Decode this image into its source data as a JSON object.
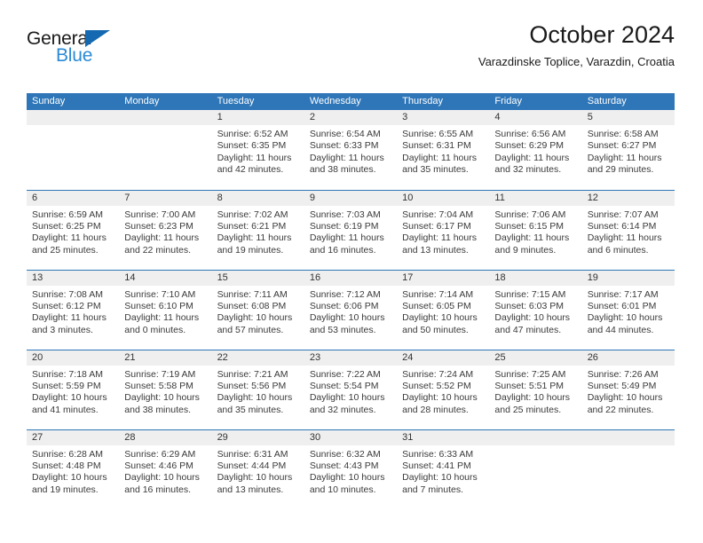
{
  "brand": {
    "name_part1": "General",
    "name_part2": "Blue",
    "color_dark": "#1a1a1a",
    "color_blue": "#2b8ad6",
    "triangle_color": "#1569b0"
  },
  "header": {
    "title": "October 2024",
    "subtitle": "Varazdinske Toplice, Varazdin, Croatia"
  },
  "theme": {
    "header_band": "#2e76b8",
    "date_band": "#efefef",
    "row_border": "#2e76b8",
    "body_text": "#3a3a3a"
  },
  "weekdays": [
    "Sunday",
    "Monday",
    "Tuesday",
    "Wednesday",
    "Thursday",
    "Friday",
    "Saturday"
  ],
  "weeks": [
    [
      {
        "day": "",
        "sunrise": "",
        "sunset": "",
        "daylight_line1": "",
        "daylight_line2": "",
        "empty": true
      },
      {
        "day": "",
        "sunrise": "",
        "sunset": "",
        "daylight_line1": "",
        "daylight_line2": "",
        "empty": true
      },
      {
        "day": "1",
        "sunrise": "Sunrise: 6:52 AM",
        "sunset": "Sunset: 6:35 PM",
        "daylight_line1": "Daylight: 11 hours",
        "daylight_line2": "and 42 minutes."
      },
      {
        "day": "2",
        "sunrise": "Sunrise: 6:54 AM",
        "sunset": "Sunset: 6:33 PM",
        "daylight_line1": "Daylight: 11 hours",
        "daylight_line2": "and 38 minutes."
      },
      {
        "day": "3",
        "sunrise": "Sunrise: 6:55 AM",
        "sunset": "Sunset: 6:31 PM",
        "daylight_line1": "Daylight: 11 hours",
        "daylight_line2": "and 35 minutes."
      },
      {
        "day": "4",
        "sunrise": "Sunrise: 6:56 AM",
        "sunset": "Sunset: 6:29 PM",
        "daylight_line1": "Daylight: 11 hours",
        "daylight_line2": "and 32 minutes."
      },
      {
        "day": "5",
        "sunrise": "Sunrise: 6:58 AM",
        "sunset": "Sunset: 6:27 PM",
        "daylight_line1": "Daylight: 11 hours",
        "daylight_line2": "and 29 minutes."
      }
    ],
    [
      {
        "day": "6",
        "sunrise": "Sunrise: 6:59 AM",
        "sunset": "Sunset: 6:25 PM",
        "daylight_line1": "Daylight: 11 hours",
        "daylight_line2": "and 25 minutes."
      },
      {
        "day": "7",
        "sunrise": "Sunrise: 7:00 AM",
        "sunset": "Sunset: 6:23 PM",
        "daylight_line1": "Daylight: 11 hours",
        "daylight_line2": "and 22 minutes."
      },
      {
        "day": "8",
        "sunrise": "Sunrise: 7:02 AM",
        "sunset": "Sunset: 6:21 PM",
        "daylight_line1": "Daylight: 11 hours",
        "daylight_line2": "and 19 minutes."
      },
      {
        "day": "9",
        "sunrise": "Sunrise: 7:03 AM",
        "sunset": "Sunset: 6:19 PM",
        "daylight_line1": "Daylight: 11 hours",
        "daylight_line2": "and 16 minutes."
      },
      {
        "day": "10",
        "sunrise": "Sunrise: 7:04 AM",
        "sunset": "Sunset: 6:17 PM",
        "daylight_line1": "Daylight: 11 hours",
        "daylight_line2": "and 13 minutes."
      },
      {
        "day": "11",
        "sunrise": "Sunrise: 7:06 AM",
        "sunset": "Sunset: 6:15 PM",
        "daylight_line1": "Daylight: 11 hours",
        "daylight_line2": "and 9 minutes."
      },
      {
        "day": "12",
        "sunrise": "Sunrise: 7:07 AM",
        "sunset": "Sunset: 6:14 PM",
        "daylight_line1": "Daylight: 11 hours",
        "daylight_line2": "and 6 minutes."
      }
    ],
    [
      {
        "day": "13",
        "sunrise": "Sunrise: 7:08 AM",
        "sunset": "Sunset: 6:12 PM",
        "daylight_line1": "Daylight: 11 hours",
        "daylight_line2": "and 3 minutes."
      },
      {
        "day": "14",
        "sunrise": "Sunrise: 7:10 AM",
        "sunset": "Sunset: 6:10 PM",
        "daylight_line1": "Daylight: 11 hours",
        "daylight_line2": "and 0 minutes."
      },
      {
        "day": "15",
        "sunrise": "Sunrise: 7:11 AM",
        "sunset": "Sunset: 6:08 PM",
        "daylight_line1": "Daylight: 10 hours",
        "daylight_line2": "and 57 minutes."
      },
      {
        "day": "16",
        "sunrise": "Sunrise: 7:12 AM",
        "sunset": "Sunset: 6:06 PM",
        "daylight_line1": "Daylight: 10 hours",
        "daylight_line2": "and 53 minutes."
      },
      {
        "day": "17",
        "sunrise": "Sunrise: 7:14 AM",
        "sunset": "Sunset: 6:05 PM",
        "daylight_line1": "Daylight: 10 hours",
        "daylight_line2": "and 50 minutes."
      },
      {
        "day": "18",
        "sunrise": "Sunrise: 7:15 AM",
        "sunset": "Sunset: 6:03 PM",
        "daylight_line1": "Daylight: 10 hours",
        "daylight_line2": "and 47 minutes."
      },
      {
        "day": "19",
        "sunrise": "Sunrise: 7:17 AM",
        "sunset": "Sunset: 6:01 PM",
        "daylight_line1": "Daylight: 10 hours",
        "daylight_line2": "and 44 minutes."
      }
    ],
    [
      {
        "day": "20",
        "sunrise": "Sunrise: 7:18 AM",
        "sunset": "Sunset: 5:59 PM",
        "daylight_line1": "Daylight: 10 hours",
        "daylight_line2": "and 41 minutes."
      },
      {
        "day": "21",
        "sunrise": "Sunrise: 7:19 AM",
        "sunset": "Sunset: 5:58 PM",
        "daylight_line1": "Daylight: 10 hours",
        "daylight_line2": "and 38 minutes."
      },
      {
        "day": "22",
        "sunrise": "Sunrise: 7:21 AM",
        "sunset": "Sunset: 5:56 PM",
        "daylight_line1": "Daylight: 10 hours",
        "daylight_line2": "and 35 minutes."
      },
      {
        "day": "23",
        "sunrise": "Sunrise: 7:22 AM",
        "sunset": "Sunset: 5:54 PM",
        "daylight_line1": "Daylight: 10 hours",
        "daylight_line2": "and 32 minutes."
      },
      {
        "day": "24",
        "sunrise": "Sunrise: 7:24 AM",
        "sunset": "Sunset: 5:52 PM",
        "daylight_line1": "Daylight: 10 hours",
        "daylight_line2": "and 28 minutes."
      },
      {
        "day": "25",
        "sunrise": "Sunrise: 7:25 AM",
        "sunset": "Sunset: 5:51 PM",
        "daylight_line1": "Daylight: 10 hours",
        "daylight_line2": "and 25 minutes."
      },
      {
        "day": "26",
        "sunrise": "Sunrise: 7:26 AM",
        "sunset": "Sunset: 5:49 PM",
        "daylight_line1": "Daylight: 10 hours",
        "daylight_line2": "and 22 minutes."
      }
    ],
    [
      {
        "day": "27",
        "sunrise": "Sunrise: 6:28 AM",
        "sunset": "Sunset: 4:48 PM",
        "daylight_line1": "Daylight: 10 hours",
        "daylight_line2": "and 19 minutes."
      },
      {
        "day": "28",
        "sunrise": "Sunrise: 6:29 AM",
        "sunset": "Sunset: 4:46 PM",
        "daylight_line1": "Daylight: 10 hours",
        "daylight_line2": "and 16 minutes."
      },
      {
        "day": "29",
        "sunrise": "Sunrise: 6:31 AM",
        "sunset": "Sunset: 4:44 PM",
        "daylight_line1": "Daylight: 10 hours",
        "daylight_line2": "and 13 minutes."
      },
      {
        "day": "30",
        "sunrise": "Sunrise: 6:32 AM",
        "sunset": "Sunset: 4:43 PM",
        "daylight_line1": "Daylight: 10 hours",
        "daylight_line2": "and 10 minutes."
      },
      {
        "day": "31",
        "sunrise": "Sunrise: 6:33 AM",
        "sunset": "Sunset: 4:41 PM",
        "daylight_line1": "Daylight: 10 hours",
        "daylight_line2": "and 7 minutes."
      },
      {
        "day": "",
        "sunrise": "",
        "sunset": "",
        "daylight_line1": "",
        "daylight_line2": "",
        "empty": true
      },
      {
        "day": "",
        "sunrise": "",
        "sunset": "",
        "daylight_line1": "",
        "daylight_line2": "",
        "empty": true
      }
    ]
  ]
}
